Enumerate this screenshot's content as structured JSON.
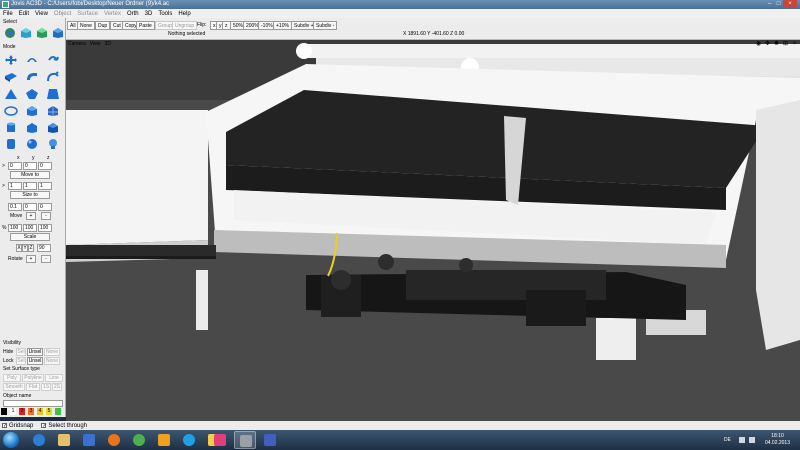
{
  "window": {
    "title": "Jovis AC3D - C:/Users/fobi/Desktop/Neuer Ordner (9)/k4.ac",
    "minimize_glyph": "–",
    "maximize_glyph": "□",
    "close_glyph": "×"
  },
  "menu": {
    "items": [
      "File",
      "Edit",
      "View",
      "Object",
      "Surface",
      "Vertex",
      "Orth",
      "3D",
      "Tools",
      "Help"
    ],
    "disabled": [
      false,
      false,
      false,
      true,
      true,
      true,
      false,
      false,
      false,
      false
    ]
  },
  "toolbar": {
    "buttons": [
      "All",
      "None",
      "Dup",
      "Cut",
      "Copy",
      "Paste",
      "Group",
      "Ungroup"
    ],
    "disabled": [
      false,
      false,
      false,
      false,
      false,
      false,
      true,
      true
    ],
    "flip_label": "Flip:",
    "flip_axes": [
      "x",
      "y",
      "z"
    ],
    "scale_buttons": [
      "50%",
      "200%",
      "-10%",
      "+10%"
    ],
    "subdiv_plus": "Subdiv +",
    "subdiv_minus": "Subdiv -",
    "status": "Nothing selected",
    "coords": "X 1891.60 Y -401.60 Z 0.00"
  },
  "left_panel": {
    "select_label": "Select",
    "mode_label": "Mode",
    "axis_headers": [
      "x",
      "y",
      "z"
    ],
    "move_values": [
      "0",
      "0",
      "0"
    ],
    "move_to_label": "Move to",
    "size_values": [
      "1",
      "1",
      "1"
    ],
    "size_to_label": "Size to",
    "move_step_values": [
      "0.1",
      "0",
      "0"
    ],
    "move_label": "Move",
    "scale_prefix": "%",
    "scale_values": [
      "100",
      "100",
      "100"
    ],
    "scale_label": "Scale",
    "rotate_axes": [
      "X",
      "Y",
      "Z"
    ],
    "rotate_step": "90",
    "rotate_label": "Rotate",
    "plus": "+",
    "minus": "-",
    "visibility_label": "Visibility",
    "hide_label": "Hide",
    "lock_label": "Lock",
    "vis_buttons": [
      "Sel",
      "Unsel",
      "None"
    ],
    "vis_disabled": [
      true,
      false,
      true
    ],
    "surface_type_label": "Set Surface type",
    "surface_row1": [
      "Poly",
      "Polyline",
      "Line"
    ],
    "surface_row2": [
      "Smooth",
      "Flat",
      "1S",
      "2S"
    ],
    "object_name_label": "Object name",
    "palette_labels": [
      "1",
      "2",
      "3",
      "4",
      "5"
    ],
    "palette_colors": [
      "#000000",
      "#ffffff",
      "#e02020",
      "#f07020",
      "#f0c020",
      "#e0e020",
      "#40c040"
    ]
  },
  "viewport": {
    "menu": [
      "Camera",
      "View",
      "3D"
    ],
    "icons": [
      "eye-icon",
      "arrows-icon",
      "light-icon",
      "grid-icon",
      "close-icon"
    ],
    "icon_glyphs": [
      "◉",
      "✥",
      "✺",
      "⊞",
      "×"
    ]
  },
  "bottom": {
    "gridsnap_label": "Gridsnap",
    "gridsnap_checked": true,
    "select_through_label": "Select through",
    "select_through_checked": true
  },
  "taskbar": {
    "apps": [
      "internet-explorer",
      "file-explorer",
      "media-player",
      "firefox",
      "chrome",
      "app-orange",
      "skype",
      "notes",
      "app-pink",
      "ac3d",
      "app-blue"
    ],
    "app_colors": [
      "#2d7fd4",
      "#e5c06a",
      "#3b6fd0",
      "#e8741c",
      "#4caf50",
      "#f0a020",
      "#1ea0e6",
      "#f3d040",
      "#e0407a",
      "#9aa0a8",
      "#4060c0"
    ],
    "active_index": 9,
    "language": "DE",
    "time": "18:10",
    "date": "04.02.2013"
  },
  "colors": {
    "viewport_bg": "#494949",
    "model_light": "#f4f4f4",
    "model_shade": "#bdbdbd",
    "model_dark": "#1c1c1c",
    "wire_highlight": "#e8d020"
  }
}
